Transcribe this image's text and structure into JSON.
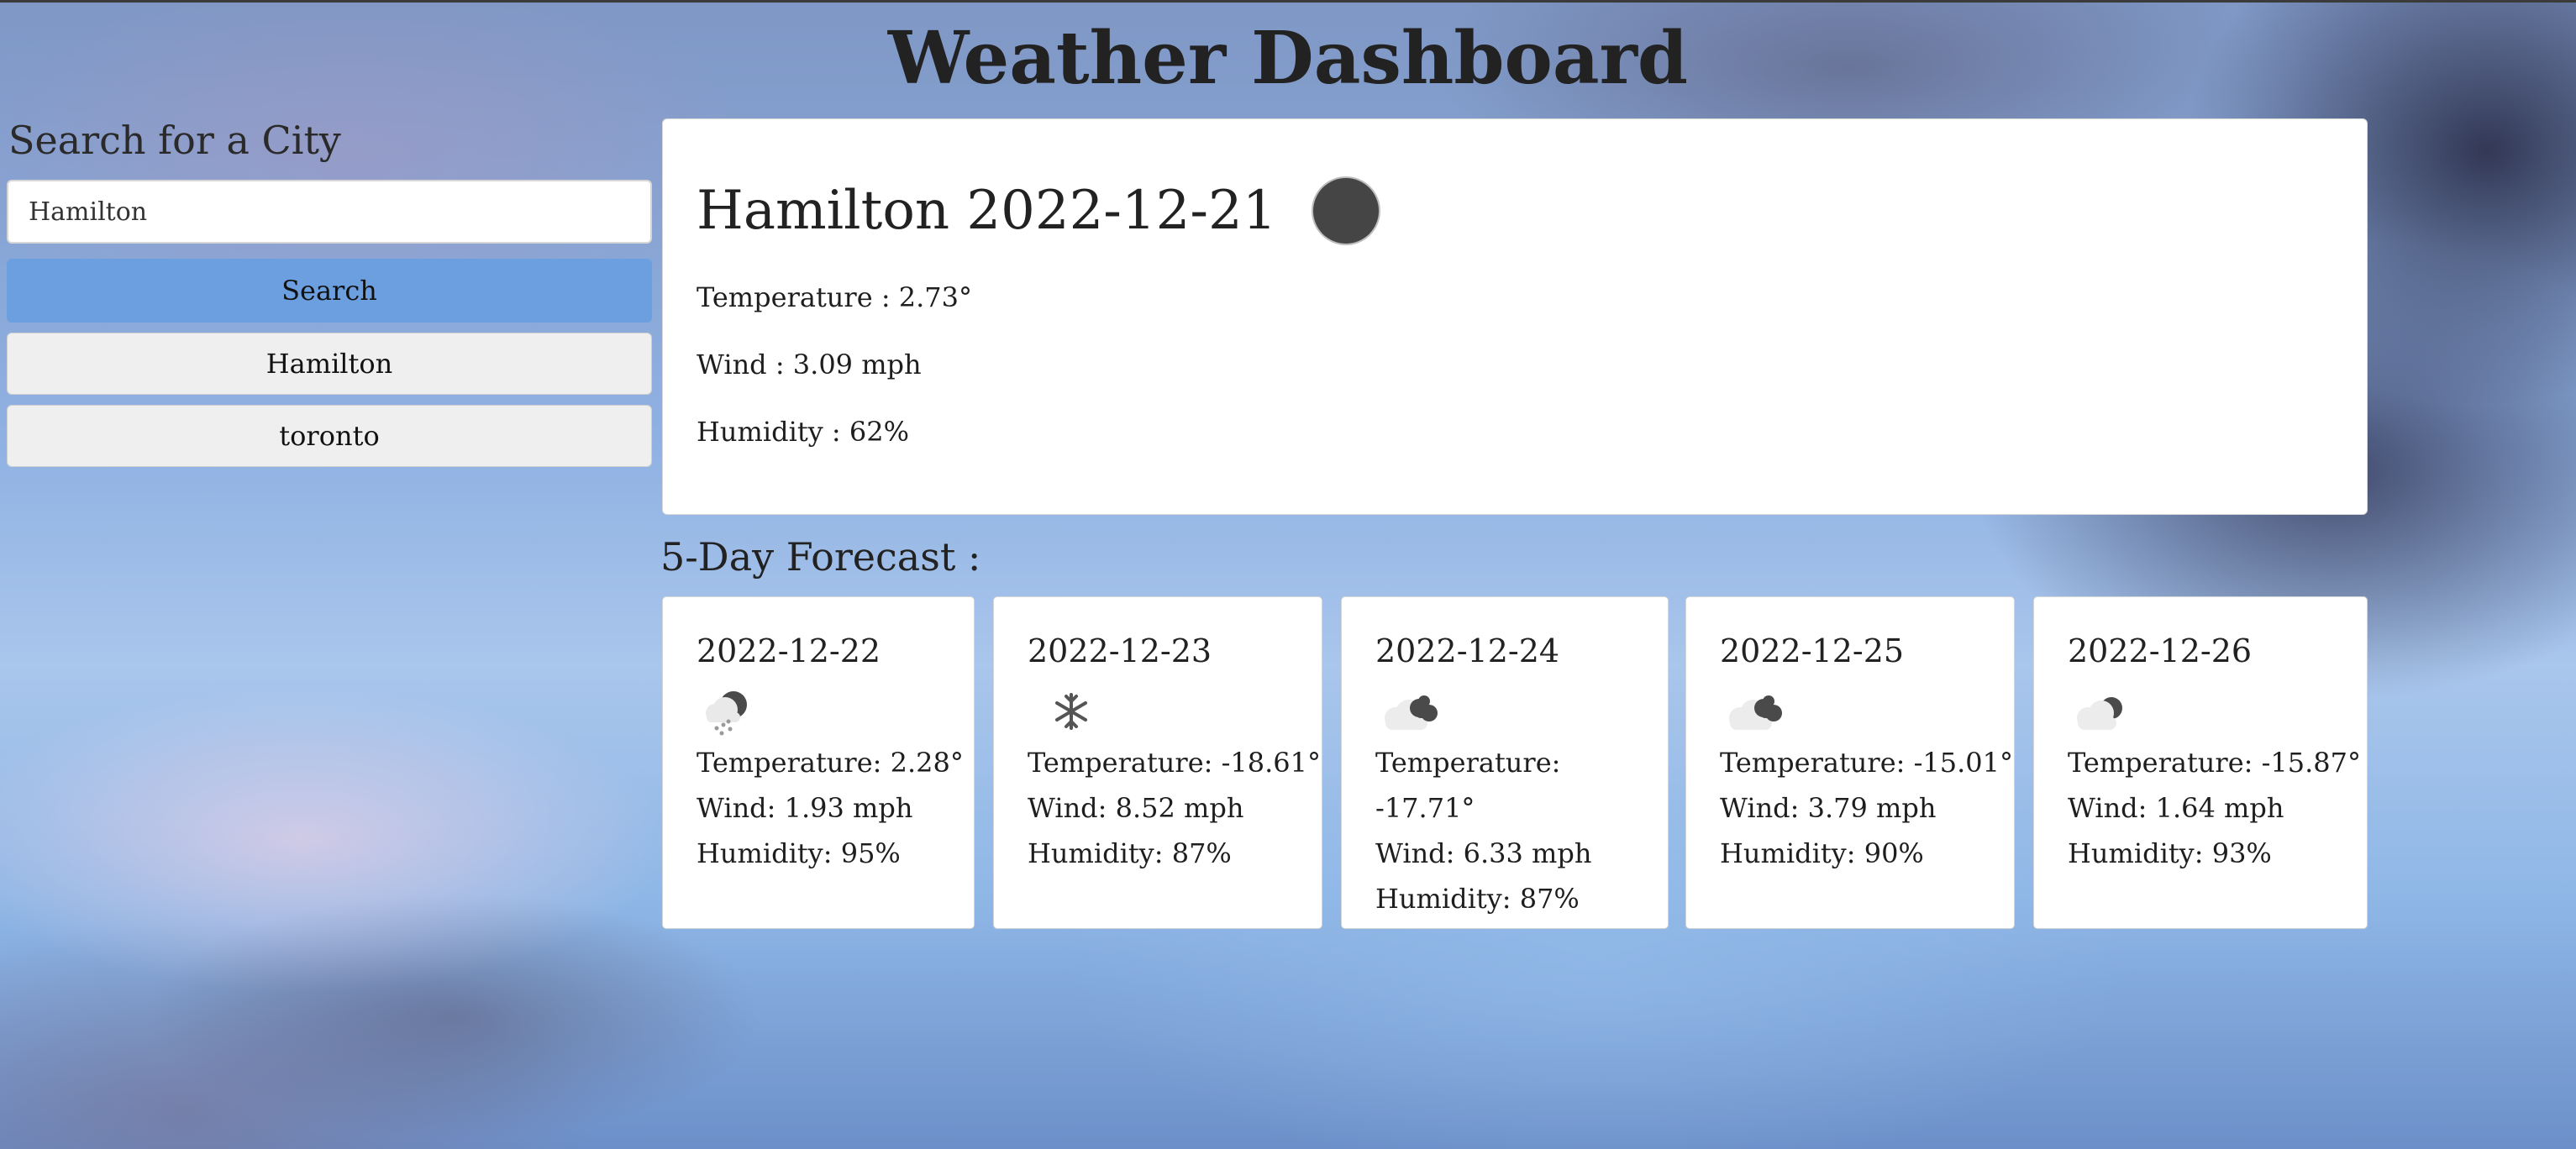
{
  "title": "Weather Dashboard",
  "sidebar": {
    "heading": "Search for a City",
    "search_value": "Hamilton",
    "search_button_label": "Search",
    "history": [
      "Hamilton",
      "toronto"
    ]
  },
  "current": {
    "city_date": "Hamilton 2022-12-21",
    "icon": "dark-circle-icon",
    "temperature": "Temperature : 2.73°",
    "wind": "Wind : 3.09 mph",
    "humidity": "Humidity : 62%"
  },
  "forecast": {
    "heading": "5-Day Forecast :",
    "days": [
      {
        "date": "2022-12-22",
        "icon": "snow-shower-icon",
        "temperature": "Temperature: 2.28°",
        "wind": "Wind: 1.93 mph",
        "humidity": "Humidity: 95%"
      },
      {
        "date": "2022-12-23",
        "icon": "snowflake-icon",
        "temperature": "Temperature: -18.61°",
        "wind": "Wind: 8.52 mph",
        "humidity": "Humidity: 87%"
      },
      {
        "date": "2022-12-24",
        "icon": "broken-clouds-icon",
        "temperature": "Temperature: -17.71°",
        "wind": "Wind: 6.33 mph",
        "humidity": "Humidity: 87%"
      },
      {
        "date": "2022-12-25",
        "icon": "broken-clouds-icon",
        "temperature": "Temperature: -15.01°",
        "wind": "Wind: 3.79 mph",
        "humidity": "Humidity: 90%"
      },
      {
        "date": "2022-12-26",
        "icon": "cloudy-icon",
        "temperature": "Temperature: -15.87°",
        "wind": "Wind: 1.64 mph",
        "humidity": "Humidity: 93%"
      }
    ]
  },
  "colors": {
    "search_button": "#6c9fe0",
    "history_button": "#efefef",
    "card_background": "#ffffff",
    "current_icon": "#454545"
  }
}
